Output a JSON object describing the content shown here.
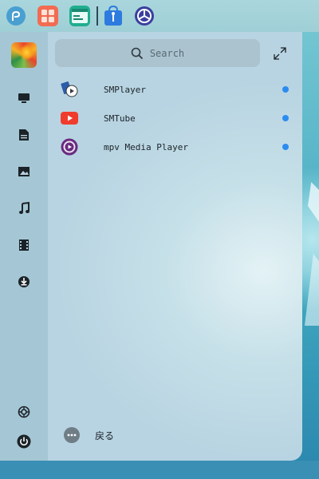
{
  "taskbar": {
    "items": [
      {
        "name": "fedora-logo-icon"
      },
      {
        "name": "app-grid-icon"
      },
      {
        "name": "terminal-icon"
      },
      {
        "name": "app-store-icon"
      },
      {
        "name": "settings-icon"
      }
    ],
    "colors": {
      "fedora": "#4a9fd1",
      "grid": "#f26b52",
      "terminal": "#1fae8f",
      "store": "#2e7be0",
      "settings": "#3a3f9e"
    }
  },
  "launcher": {
    "search": {
      "placeholder": "Search"
    },
    "categories": [
      {
        "name": "computer-icon"
      },
      {
        "name": "document-icon"
      },
      {
        "name": "picture-icon"
      },
      {
        "name": "music-icon"
      },
      {
        "name": "video-icon"
      },
      {
        "name": "download-icon"
      }
    ],
    "apps": [
      {
        "label": "SMPlayer",
        "icon": "smplayer-icon",
        "new": true
      },
      {
        "label": "SMTube",
        "icon": "smtube-icon",
        "new": true
      },
      {
        "label": "mpv Media Player",
        "icon": "mpv-icon",
        "new": true
      }
    ],
    "back_label": "戻る",
    "accent": "#2a8cf0"
  }
}
